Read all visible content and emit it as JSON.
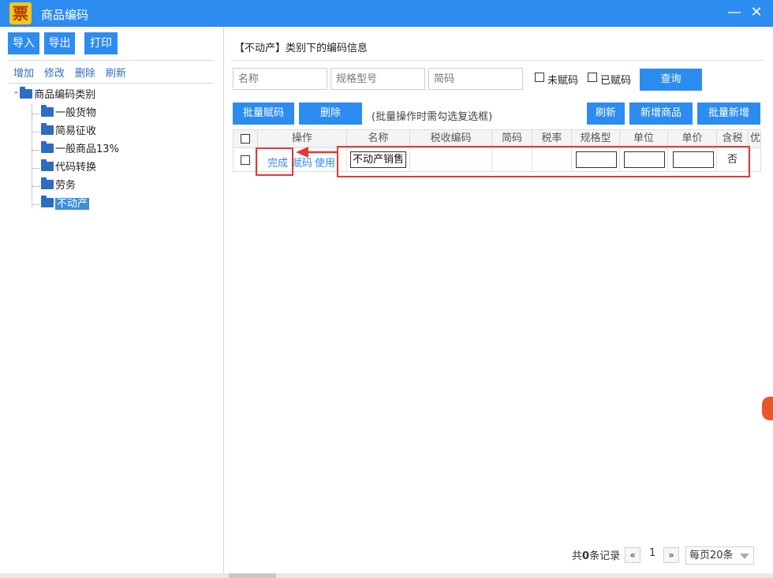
{
  "window": {
    "logo_text": "票",
    "title": "商品编码",
    "minimize_label": "—",
    "close_label": "✕"
  },
  "left_toolbar": {
    "import_label": "导入",
    "export_label": "导出",
    "print_label": "打印"
  },
  "left_actions": {
    "add_label": "增加",
    "edit_label": "修改",
    "delete_label": "删除",
    "refresh_label": "刷新"
  },
  "tree": {
    "root_label": "商品编码类别",
    "items": [
      {
        "label": "一般货物"
      },
      {
        "label": "简易征收"
      },
      {
        "label": "一般商品13%"
      },
      {
        "label": "代码转换"
      },
      {
        "label": "劳务"
      },
      {
        "label": "不动产"
      }
    ],
    "selected": "不动产"
  },
  "main": {
    "section_title": "【不动产】类别下的编码信息",
    "search": {
      "name_placeholder": "名称",
      "spec_placeholder": "规格型号",
      "short_code_placeholder": "简码",
      "unassigned_label": "未赋码",
      "assigned_label": "已赋码",
      "query_label": "查询"
    },
    "actions": {
      "batch_assign_label": "批量赋码",
      "delete_label": "删除",
      "hint": "(批量操作时需勾选复选框)",
      "refresh_label": "刷新",
      "new_item_label": "新增商品",
      "batch_add_label": "批量新增"
    },
    "table": {
      "columns": [
        "操作",
        "名称",
        "税收编码",
        "简码",
        "税率",
        "规格型",
        "单位",
        "单价",
        "含税",
        "优"
      ],
      "rows": [
        {
          "done_label": "完成",
          "assign_label": "赋码",
          "use_label": "使用",
          "name": "不动产销售",
          "tax_code": "",
          "short_code": "",
          "tax_rate": "",
          "spec": "",
          "unit": "",
          "price": "",
          "tax_included": "否"
        }
      ]
    },
    "pagination": {
      "total_prefix": "共",
      "total_count": "0",
      "total_suffix": "条记录",
      "prev_label": "«",
      "current_page": "1",
      "next_label": "»",
      "page_size_label": "每页20条"
    }
  },
  "colors": {
    "titlebar": "#2d8cf0",
    "button": "#2d8cf0",
    "highlight": "#e53935",
    "link": "#2d8cf0"
  }
}
